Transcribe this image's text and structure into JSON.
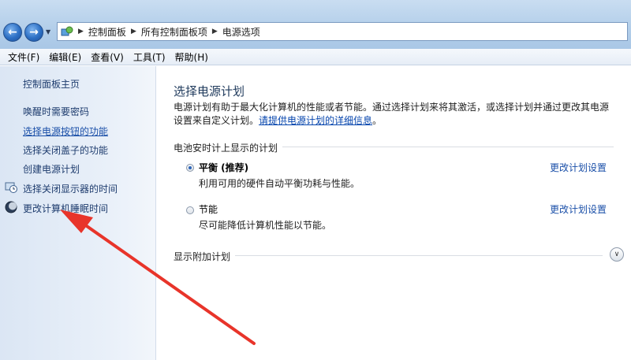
{
  "address": {
    "crumbs": [
      "控制面板",
      "所有控制面板项",
      "电源选项"
    ]
  },
  "menu": [
    "文件(F)",
    "编辑(E)",
    "查看(V)",
    "工具(T)",
    "帮助(H)"
  ],
  "sidebar": {
    "home": "控制面板主页",
    "items": [
      "唤醒时需要密码",
      "选择电源按钮的功能",
      "选择关闭盖子的功能",
      "创建电源计划",
      "选择关闭显示器的时间",
      "更改计算机睡眠时间"
    ]
  },
  "main": {
    "title": "选择电源计划",
    "desc_text": "电源计划有助于最大化计算机的性能或者节能。通过选择计划来将其激活，或选择计划并通过更改其电源设置来自定义计划。",
    "desc_link": "请提供电源计划的详细信息",
    "desc_end": "。",
    "group_label": "电池安时计上显示的计划",
    "plans": [
      {
        "name": "平衡 (推荐)",
        "desc": "利用可用的硬件自动平衡功耗与性能。",
        "link": "更改计划设置",
        "selected": true
      },
      {
        "name": "节能",
        "desc": "尽可能降低计算机性能以节能。",
        "link": "更改计划设置",
        "selected": false
      }
    ],
    "more_label": "显示附加计划"
  },
  "colors": {
    "annotation_arrow": "#e8342a",
    "link": "#1a4fa8",
    "title": "#1e395b"
  }
}
